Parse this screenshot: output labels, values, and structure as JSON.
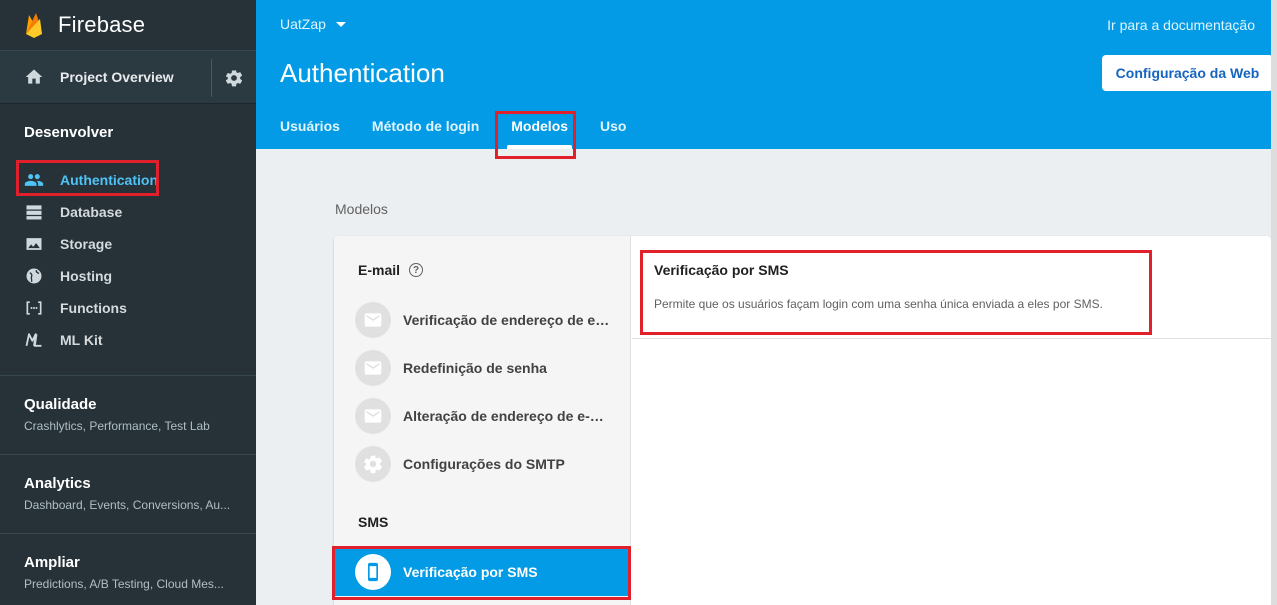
{
  "app": {
    "name": "Firebase"
  },
  "sidebar": {
    "overview_label": "Project Overview",
    "develop": {
      "title": "Desenvolver",
      "items": [
        {
          "label": "Authentication",
          "icon": "people-icon",
          "active": true
        },
        {
          "label": "Database",
          "icon": "database-icon"
        },
        {
          "label": "Storage",
          "icon": "image-icon"
        },
        {
          "label": "Hosting",
          "icon": "globe-icon"
        },
        {
          "label": "Functions",
          "icon": "functions-icon"
        },
        {
          "label": "ML Kit",
          "icon": "mlkit-icon"
        }
      ]
    },
    "groups": [
      {
        "title": "Qualidade",
        "subtitle": "Crashlytics, Performance, Test Lab"
      },
      {
        "title": "Analytics",
        "subtitle": "Dashboard, Events, Conversions, Au..."
      },
      {
        "title": "Ampliar",
        "subtitle": "Predictions, A/B Testing, Cloud Mes..."
      }
    ]
  },
  "header": {
    "project": "UatZap",
    "docs_link": "Ir para a documentação",
    "title": "Authentication",
    "web_button": "Configuração da Web",
    "tabs": [
      {
        "label": "Usuários"
      },
      {
        "label": "Método de login"
      },
      {
        "label": "Modelos",
        "active": true
      },
      {
        "label": "Uso"
      }
    ]
  },
  "content": {
    "breadcrumb": "Modelos",
    "email_section": "E-mail",
    "sms_section": "SMS",
    "templates": [
      {
        "label": "Verificação de endereço de e-mail",
        "icon": "mail-icon"
      },
      {
        "label": "Redefinição de senha",
        "icon": "mail-icon"
      },
      {
        "label": "Alteração de endereço de e-mail",
        "icon": "mail-icon"
      },
      {
        "label": "Configurações do SMTP",
        "icon": "gear-icon"
      }
    ],
    "sms_template": {
      "label": "Verificação por SMS",
      "icon": "phone-icon"
    },
    "detail": {
      "title": "Verificação por SMS",
      "description": "Permite que os usuários façam login com uma senha única enviada a eles por SMS."
    }
  },
  "colors": {
    "header_blue": "#039be5",
    "sidebar_bg": "#263238",
    "active_link": "#4fc3f7",
    "highlight_red": "#e0202b"
  }
}
